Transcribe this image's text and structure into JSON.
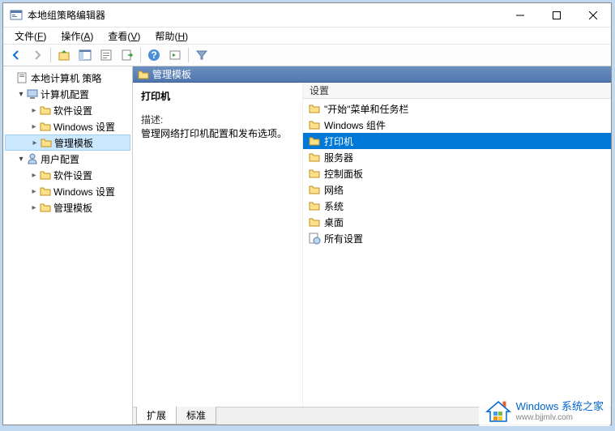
{
  "window": {
    "title": "本地组策略编辑器"
  },
  "menubar": {
    "items": [
      {
        "label": "文件",
        "key": "F"
      },
      {
        "label": "操作",
        "key": "A"
      },
      {
        "label": "查看",
        "key": "V"
      },
      {
        "label": "帮助",
        "key": "H"
      }
    ]
  },
  "tree": {
    "root": {
      "label": "本地计算机 策略"
    },
    "computer": {
      "label": "计算机配置"
    },
    "computer_children": [
      {
        "label": "软件设置"
      },
      {
        "label": "Windows 设置"
      },
      {
        "label": "管理模板"
      }
    ],
    "user": {
      "label": "用户配置"
    },
    "user_children": [
      {
        "label": "软件设置"
      },
      {
        "label": "Windows 设置"
      },
      {
        "label": "管理模板"
      }
    ]
  },
  "header": {
    "title": "管理模板"
  },
  "desc": {
    "title": "打印机",
    "label": "描述:",
    "text": "管理网络打印机配置和发布选项。"
  },
  "list": {
    "header": "设置",
    "items": [
      {
        "label": "\"开始\"菜单和任务栏",
        "type": "folder"
      },
      {
        "label": "Windows 组件",
        "type": "folder"
      },
      {
        "label": "打印机",
        "type": "folder",
        "selected": true
      },
      {
        "label": "服务器",
        "type": "folder"
      },
      {
        "label": "控制面板",
        "type": "folder"
      },
      {
        "label": "网络",
        "type": "folder"
      },
      {
        "label": "系统",
        "type": "folder"
      },
      {
        "label": "桌面",
        "type": "folder"
      },
      {
        "label": "所有设置",
        "type": "settings"
      }
    ]
  },
  "tabs": {
    "extended": "扩展",
    "standard": "标准"
  },
  "watermark": {
    "cn": "Windows 系统之家",
    "en": "www.bjjmlv.com"
  }
}
